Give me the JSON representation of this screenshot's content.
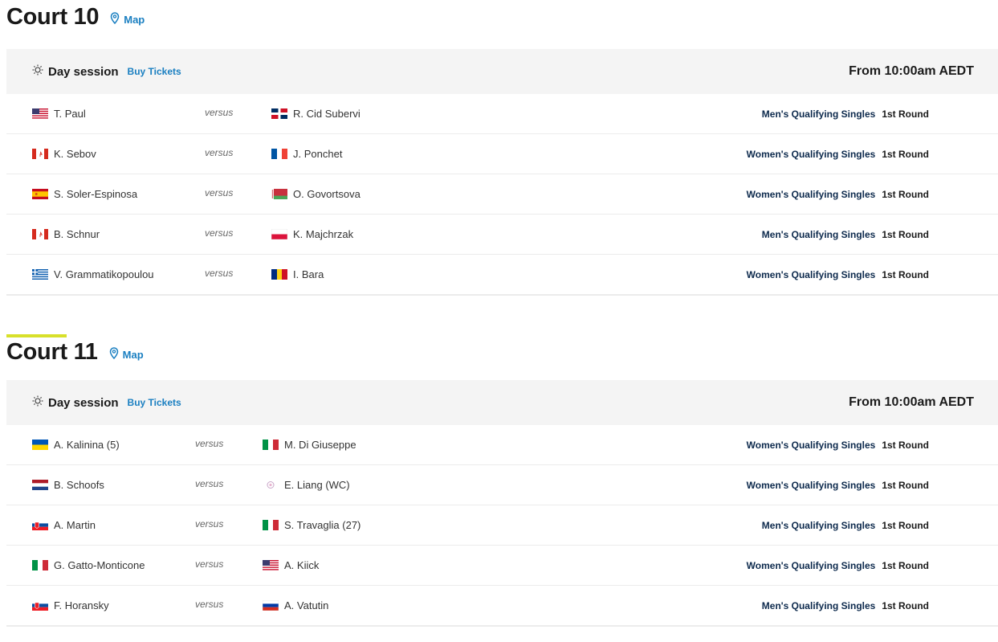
{
  "courts": [
    {
      "title": "Court 10",
      "map_label": "Map",
      "session": {
        "name": "Day session",
        "buy_label": "Buy Tickets",
        "time": "From 10:00am AEDT"
      },
      "matches": [
        {
          "p1": "T. Paul",
          "p1_flag": "usa-flag",
          "versus": "versus",
          "p2": "R. Cid Subervi",
          "p2_flag": "dominican-republic-flag",
          "event": "Men's Qualifying Singles",
          "round": "1st Round"
        },
        {
          "p1": "K. Sebov",
          "p1_flag": "canada-flag",
          "versus": "versus",
          "p2": "J. Ponchet",
          "p2_flag": "france-flag",
          "event": "Women's Qualifying Singles",
          "round": "1st Round"
        },
        {
          "p1": "S. Soler-Espinosa",
          "p1_flag": "spain-flag",
          "versus": "versus",
          "p2": "O. Govortsova",
          "p2_flag": "belarus-flag",
          "event": "Women's Qualifying Singles",
          "round": "1st Round"
        },
        {
          "p1": "B. Schnur",
          "p1_flag": "canada-flag",
          "versus": "versus",
          "p2": "K. Majchrzak",
          "p2_flag": "poland-flag",
          "event": "Men's Qualifying Singles",
          "round": "1st Round"
        },
        {
          "p1": "V. Grammatikopoulou",
          "p1_flag": "greece-flag",
          "versus": "versus",
          "p2": "I. Bara",
          "p2_flag": "romania-flag",
          "event": "Women's Qualifying Singles",
          "round": "1st Round"
        }
      ]
    },
    {
      "title": "Court 11",
      "map_label": "Map",
      "session": {
        "name": "Day session",
        "buy_label": "Buy Tickets",
        "time": "From 10:00am AEDT"
      },
      "matches": [
        {
          "p1": "A. Kalinina (5)",
          "p1_flag": "ukraine-flag",
          "versus": "versus",
          "p2": "M. Di Giuseppe",
          "p2_flag": "italy-flag",
          "event": "Women's Qualifying Singles",
          "round": "1st Round"
        },
        {
          "p1": "B. Schoofs",
          "p1_flag": "netherlands-flag",
          "versus": "versus",
          "p2": "E. Liang (WC)",
          "p2_flag": "taipei-flag",
          "event": "Women's Qualifying Singles",
          "round": "1st Round"
        },
        {
          "p1": "A. Martin",
          "p1_flag": "slovakia-flag",
          "versus": "versus",
          "p2": "S. Travaglia (27)",
          "p2_flag": "italy-flag",
          "event": "Men's Qualifying Singles",
          "round": "1st Round"
        },
        {
          "p1": "G. Gatto-Monticone",
          "p1_flag": "italy-flag",
          "versus": "versus",
          "p2": "A. Kiick",
          "p2_flag": "usa-flag",
          "event": "Women's Qualifying Singles",
          "round": "1st Round"
        },
        {
          "p1": "F. Horansky",
          "p1_flag": "slovakia-flag",
          "versus": "versus",
          "p2": "A. Vatutin",
          "p2_flag": "russia-flag",
          "event": "Men's Qualifying Singles",
          "round": "1st Round"
        }
      ]
    }
  ],
  "colors": {
    "accent_bar": "#d8e02a",
    "link": "#1a7fc1",
    "event_text": "#0d2a4d",
    "session_bg": "#f4f4f4"
  }
}
